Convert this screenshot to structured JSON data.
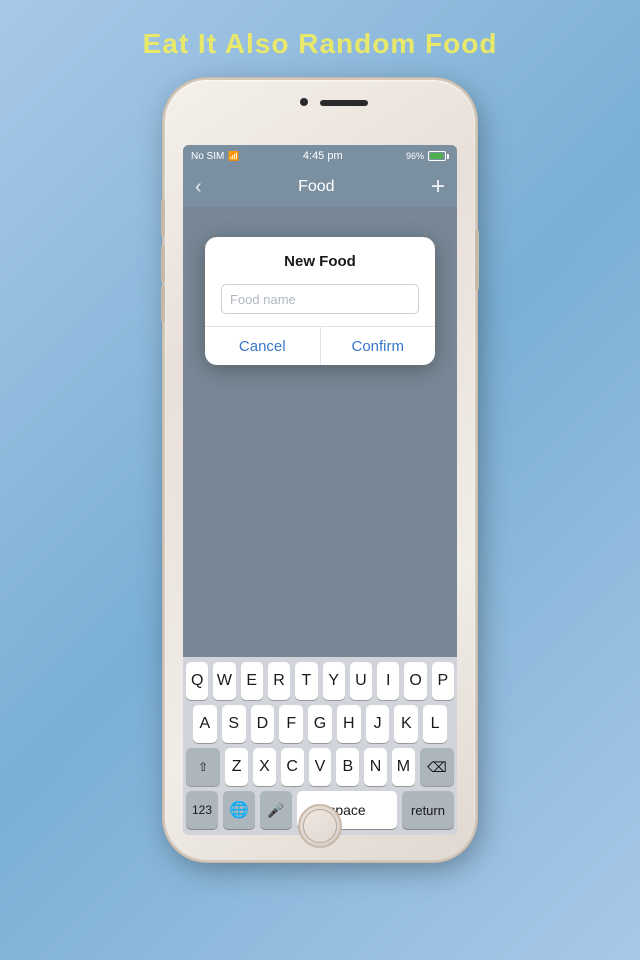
{
  "app": {
    "title": "Eat It Also Random Food"
  },
  "status_bar": {
    "carrier": "No SIM",
    "time": "4:45 pm",
    "battery_percent": "96%"
  },
  "nav_bar": {
    "title": "Food",
    "back_icon": "‹",
    "add_icon": "+"
  },
  "dialog": {
    "title": "New Food",
    "input_placeholder": "Food name",
    "cancel_label": "Cancel",
    "confirm_label": "Confirm"
  },
  "keyboard": {
    "rows": [
      [
        "Q",
        "W",
        "E",
        "R",
        "T",
        "Y",
        "U",
        "I",
        "O",
        "P"
      ],
      [
        "A",
        "S",
        "D",
        "F",
        "G",
        "H",
        "J",
        "K",
        "L"
      ],
      [
        "Z",
        "X",
        "C",
        "V",
        "B",
        "N",
        "M"
      ]
    ],
    "bottom": {
      "numbers_label": "123",
      "space_label": "space",
      "return_label": "return"
    }
  }
}
